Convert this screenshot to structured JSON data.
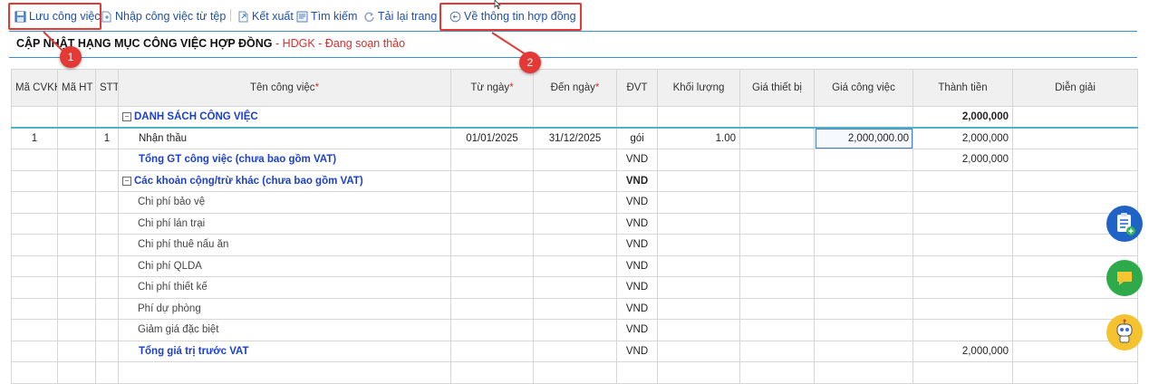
{
  "toolbar": {
    "save": "Lưu công việc",
    "import": "Nhập công việc từ tệp",
    "export": "Kết xuất",
    "search": "Tìm kiếm",
    "reload": "Tải lại trang",
    "back": "Về thông tin hợp đồng"
  },
  "page": {
    "title": "CẬP NHẬT HẠNG MỤC CÔNG VIỆC HỢP ĐỒNG",
    "subtitle": "- HDGK - Đang soạn thảo"
  },
  "callouts": [
    "1",
    "2"
  ],
  "table": {
    "headers": {
      "ma_cvkh": "Mã CVKH",
      "ma_ht": "Mã HT",
      "stt": "STT",
      "ten": "Tên công việc",
      "tu_ngay": "Từ ngày",
      "den_ngay": "Đến ngày",
      "dvt": "ĐVT",
      "khoi_luong": "Khối lượng",
      "gia_tb": "Giá thiết bị",
      "gia_cv": "Giá công việc",
      "thanh_tien": "Thành tiền",
      "dien_giai": "Diễn giải"
    },
    "section1": {
      "label": "DANH SÁCH CÔNG VIỆC",
      "total": "2,000,000"
    },
    "row1": {
      "ma_cvkh": "1",
      "stt": "1",
      "ten": "Nhận thầu",
      "tu_ngay": "01/01/2025",
      "den_ngay": "31/12/2025",
      "dvt": "gói",
      "khoi_luong": "1.00",
      "gia_cv": "2,000,000.00",
      "thanh_tien": "2,000,000"
    },
    "subtotal": {
      "label": "Tổng GT công việc (chưa bao gồm VAT)",
      "dvt": "VND",
      "thanh_tien": "2,000,000"
    },
    "section2": {
      "label": "Các khoản cộng/trừ khác (chưa bao gồm VAT)",
      "dvt": "VND"
    },
    "items": [
      {
        "ten": "Chi phí bảo vệ",
        "dvt": "VND"
      },
      {
        "ten": "Chi phí lán trại",
        "dvt": "VND"
      },
      {
        "ten": "Chi phí thuê nấu ăn",
        "dvt": "VND"
      },
      {
        "ten": "Chi phí QLDA",
        "dvt": "VND"
      },
      {
        "ten": "Chi phí thiết kế",
        "dvt": "VND"
      },
      {
        "ten": "Phí dự phòng",
        "dvt": "VND"
      },
      {
        "ten": "Giảm giá đặc biệt",
        "dvt": "VND"
      }
    ],
    "pre_vat": {
      "label": "Tổng giá trị trước VAT",
      "dvt": "VND",
      "thanh_tien": "2,000,000"
    }
  },
  "side_buttons": [
    "clipboard-add-icon",
    "chat-icon",
    "robot-support-icon"
  ],
  "colors": {
    "accent": "#1f4fa8",
    "highlight": "#e53935",
    "divider": "#3a8fd6"
  }
}
